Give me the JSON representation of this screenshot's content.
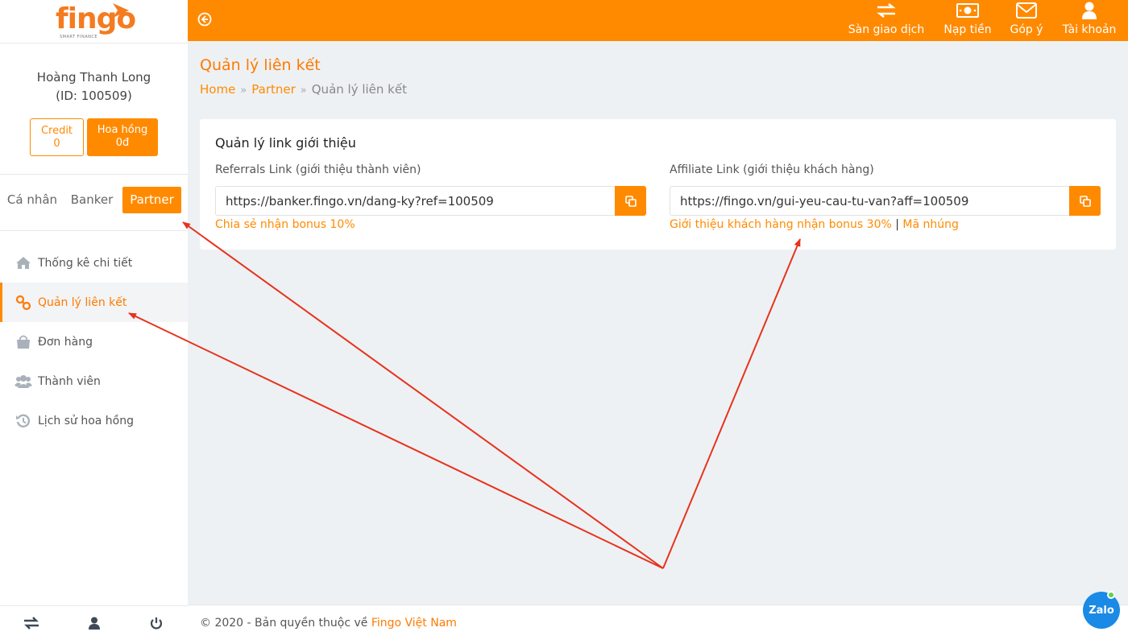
{
  "brand": {
    "logo_text": "fingo",
    "logo_tagline": "SMART FINANCE",
    "color": "#ff8a00"
  },
  "user": {
    "name": "Hoàng Thanh Long",
    "id_text": "(ID: 100509)"
  },
  "balances": {
    "credit_label": "Credit",
    "credit_value": "0",
    "commission_label": "Hoa hồng",
    "commission_value": "0đ"
  },
  "roles": {
    "tabs": [
      "Cá nhân",
      "Banker",
      "Partner"
    ],
    "active": "Partner"
  },
  "sidebar": {
    "items": [
      {
        "label": "Thống kê chi tiết",
        "icon": "home-icon"
      },
      {
        "label": "Quản lý liên kết",
        "icon": "link-icon",
        "active": true
      },
      {
        "label": "Đơn hàng",
        "icon": "shopping-bag-icon"
      },
      {
        "label": "Thành viên",
        "icon": "users-icon"
      },
      {
        "label": "Lịch sử hoa hồng",
        "icon": "history-icon"
      }
    ],
    "bottom_icons": [
      "exchange-icon",
      "user-icon",
      "power-icon"
    ]
  },
  "topbar": {
    "back_icon": "back-circle-icon",
    "nav": [
      {
        "label": "Sàn giao dịch",
        "icon": "exchange-icon"
      },
      {
        "label": "Nạp tiền",
        "icon": "money-icon"
      },
      {
        "label": "Góp ý",
        "icon": "envelope-icon"
      },
      {
        "label": "Tài khoản",
        "icon": "user-icon"
      }
    ]
  },
  "page": {
    "title": "Quản lý liên kết",
    "breadcrumb": [
      "Home",
      "Partner",
      "Quản lý liên kết"
    ]
  },
  "card": {
    "title": "Quản lý link giới thiệu",
    "referral": {
      "label": "Referrals Link (giới thiệu thành viên)",
      "value": "https://banker.fingo.vn/dang-ky?ref=100509",
      "hint": "Chia sẻ nhận bonus 10%"
    },
    "affiliate": {
      "label": "Affiliate Link (giới thiệu khách hàng)",
      "value": "https://fingo.vn/gui-yeu-cau-tu-van?aff=100509",
      "hint": "Giới thiệu khách hàng nhận bonus 30%",
      "separator": "|",
      "embed_link": "Mã nhúng"
    }
  },
  "footer": {
    "text": "© 2020 - Bản quyền thuộc về ",
    "link": "Fingo Việt Nam"
  },
  "chat_widget": {
    "label": "Zalo"
  },
  "annotation_color": "#e8321c"
}
